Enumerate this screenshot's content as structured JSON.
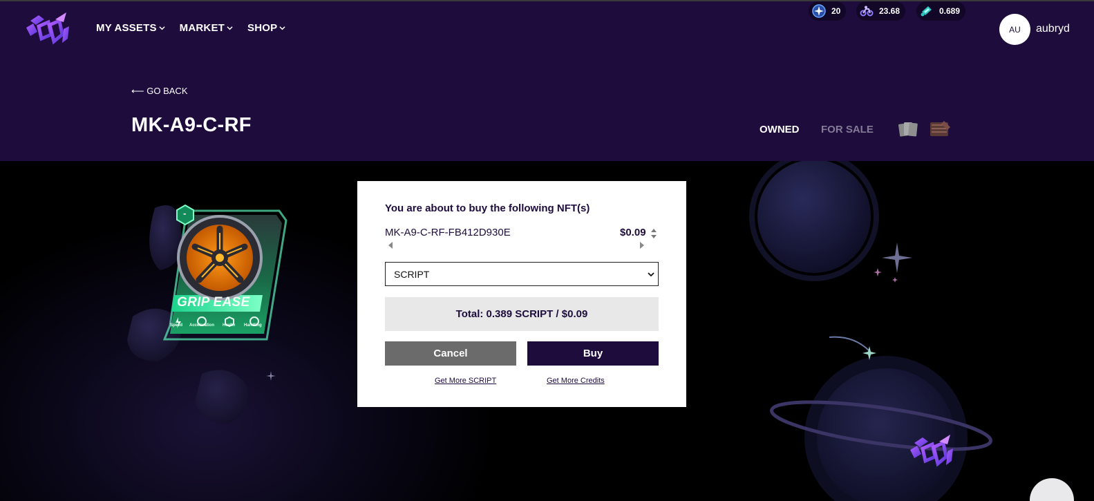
{
  "header": {
    "logo_icon": "brand-logo-icon",
    "nav": [
      {
        "label": "MY ASSETS"
      },
      {
        "label": "MARKET"
      },
      {
        "label": "SHOP"
      }
    ],
    "balances": [
      {
        "icon": "star-token-icon",
        "value": "20"
      },
      {
        "icon": "bike-token-icon",
        "value": "23.68"
      },
      {
        "icon": "ticket-token-icon",
        "value": "0.689"
      }
    ],
    "user": {
      "initials": "AU",
      "name": "aubryd"
    }
  },
  "page": {
    "back_label": "⟵ GO BACK",
    "title": "MK-A9-C-RF",
    "tabs": {
      "owned": "OWNED",
      "for_sale": "FOR SALE"
    }
  },
  "card": {
    "badge": "-",
    "name": "GRIP EASE",
    "stats": [
      "Speed",
      "Acceleration",
      "Health",
      "Handling"
    ]
  },
  "modal": {
    "heading": "You are about to buy the following NFT(s)",
    "nft_id": "MK-A9-C-RF-FB412D930E",
    "price": "$0.09",
    "currency_selected": "SCRIPT",
    "total": "Total: 0.389 SCRIPT / $0.09",
    "cancel_label": "Cancel",
    "buy_label": "Buy",
    "link_script": "Get More SCRIPT",
    "link_credits": "Get More Credits"
  },
  "colors": {
    "header_bg": "#1d0c3c",
    "buy_button": "#1d0c3c",
    "cancel_button": "#6b6b6b",
    "card_green": "#2fd38a"
  }
}
